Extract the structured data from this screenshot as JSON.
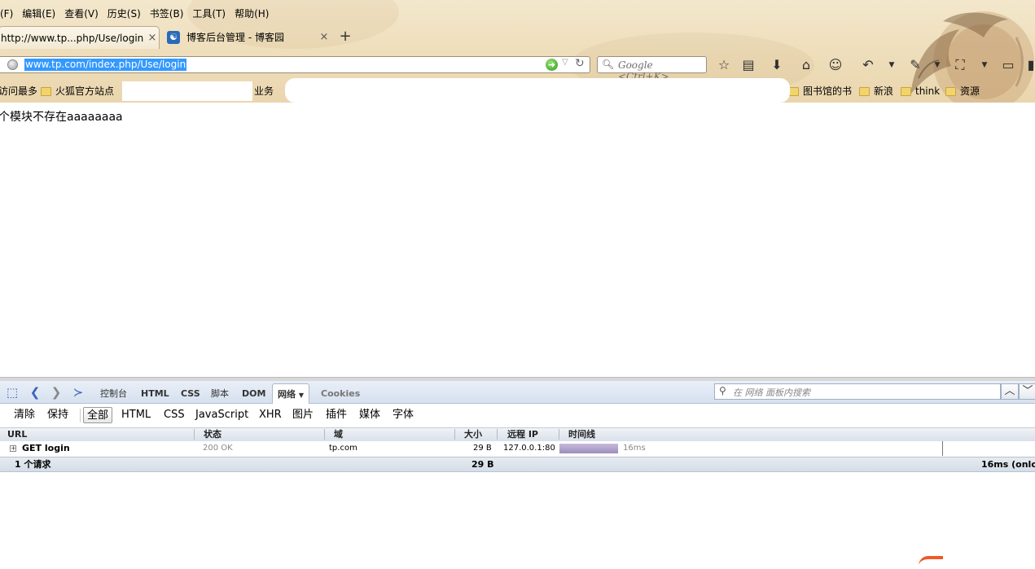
{
  "menubar": {
    "items": [
      "(F)",
      "编辑(E)",
      "查看(V)",
      "历史(S)",
      "书签(B)",
      "工具(T)",
      "帮助(H)"
    ]
  },
  "tabs": [
    {
      "title": "http://www.tp...php/Use/login",
      "close": "×"
    },
    {
      "title": "博客后台管理 - 博客园",
      "close": "×"
    }
  ],
  "new_tab": "+",
  "urlbar": {
    "value": "www.tp.com/index.php/Use/login"
  },
  "searchbar": {
    "placeholder": "Google <Ctrl+K>"
  },
  "bookmarks": {
    "left": [
      "访问最多",
      "火狐官方站点"
    ],
    "partial": "业务",
    "right": [
      "图书馆的书",
      "新浪",
      "think",
      "资源"
    ]
  },
  "page": {
    "message": "个模块不存在aaaaaaaa"
  },
  "firebug": {
    "tabs": [
      "控制台",
      "HTML",
      "CSS",
      "脚本",
      "DOM",
      "网络",
      "Cookies"
    ],
    "selected_tab": "网络",
    "search_placeholder": "在 网络 面板内搜索",
    "actions": [
      "清除",
      "保持"
    ],
    "filters": [
      "全部",
      "HTML",
      "CSS",
      "JavaScript",
      "XHR",
      "图片",
      "插件",
      "媒体",
      "字体"
    ],
    "selected_filter": "全部",
    "columns": [
      "URL",
      "状态",
      "域",
      "大小",
      "远程 IP",
      "时间线"
    ],
    "requests": [
      {
        "url": "GET login",
        "status": "200 OK",
        "domain": "tp.com",
        "size": "29 B",
        "remote_ip": "127.0.0.1:80",
        "time": "16ms"
      }
    ],
    "summary": {
      "count": "1 个请求",
      "size": "29 B",
      "time": "16ms (onload"
    }
  },
  "colors": {
    "selection": "#3399ff",
    "timeline_bar": "#9d8cbc",
    "toolbar_blue": "#d6e1ef"
  }
}
